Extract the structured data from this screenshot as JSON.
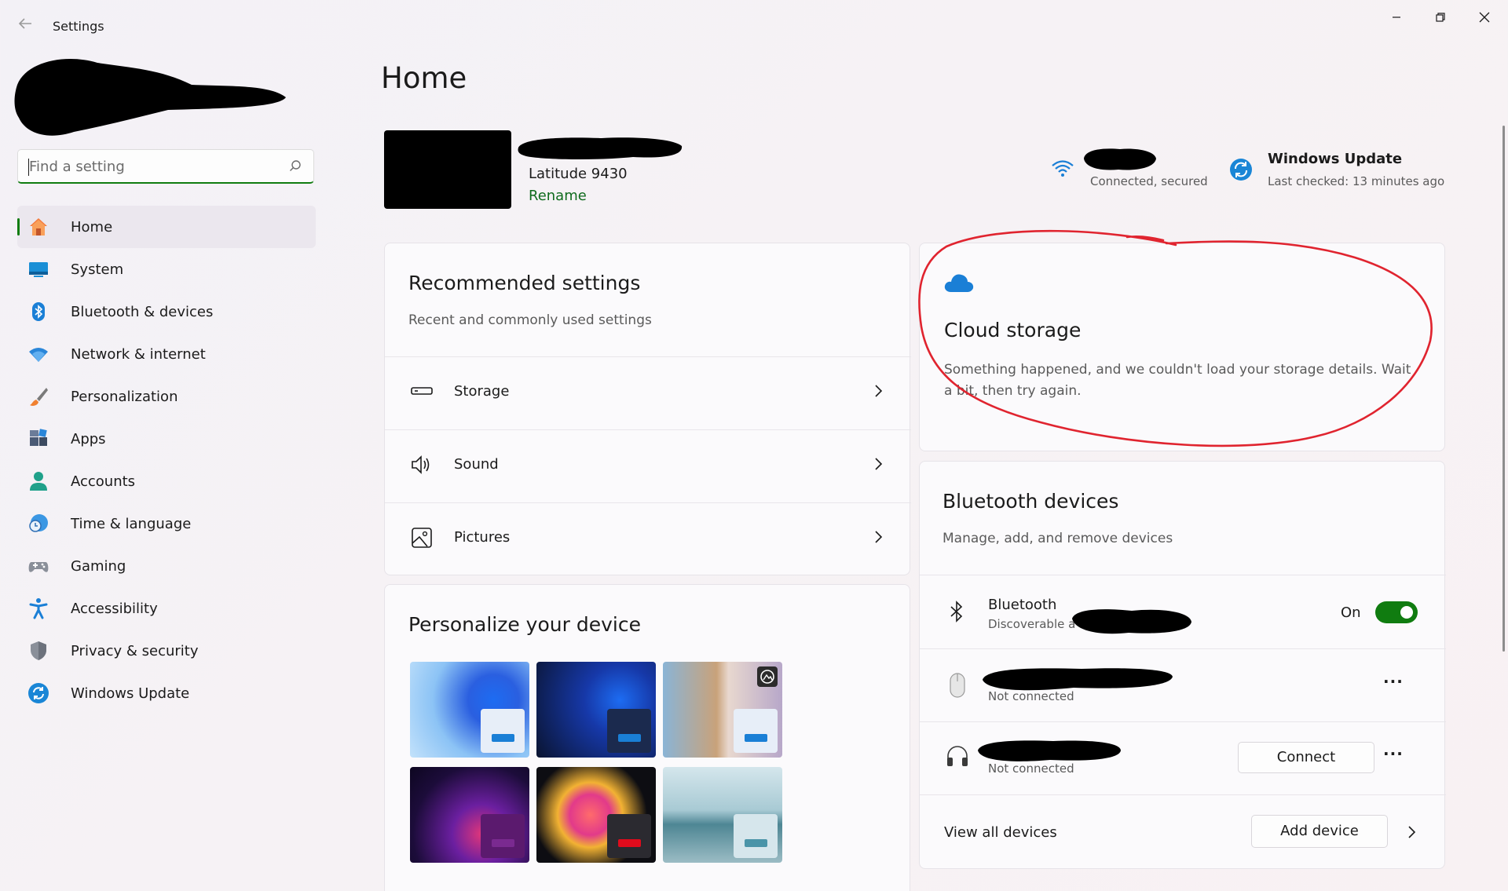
{
  "window": {
    "title": "Settings",
    "controls": [
      "minimize",
      "restore",
      "close"
    ]
  },
  "search": {
    "placeholder": "Find a setting"
  },
  "sidebar": {
    "items": [
      {
        "label": "Home",
        "icon": "home-icon",
        "active": true
      },
      {
        "label": "System",
        "icon": "system-icon"
      },
      {
        "label": "Bluetooth & devices",
        "icon": "bluetooth-icon"
      },
      {
        "label": "Network & internet",
        "icon": "wifi-icon"
      },
      {
        "label": "Personalization",
        "icon": "brush-icon"
      },
      {
        "label": "Apps",
        "icon": "apps-icon"
      },
      {
        "label": "Accounts",
        "icon": "person-icon"
      },
      {
        "label": "Time & language",
        "icon": "clock-globe-icon"
      },
      {
        "label": "Gaming",
        "icon": "gamepad-icon"
      },
      {
        "label": "Accessibility",
        "icon": "accessibility-icon"
      },
      {
        "label": "Privacy & security",
        "icon": "shield-icon"
      },
      {
        "label": "Windows Update",
        "icon": "update-icon"
      }
    ]
  },
  "main": {
    "title": "Home",
    "device": {
      "model": "Latitude 9430",
      "rename_label": "Rename"
    },
    "network": {
      "status": "Connected, secured"
    },
    "windows_update": {
      "title": "Windows Update",
      "status": "Last checked: 13 minutes ago"
    },
    "recommended": {
      "title": "Recommended settings",
      "subtitle": "Recent and commonly used settings",
      "rows": [
        {
          "label": "Storage",
          "icon": "storage-icon"
        },
        {
          "label": "Sound",
          "icon": "speaker-icon"
        },
        {
          "label": "Pictures",
          "icon": "picture-icon"
        }
      ]
    },
    "personalize": {
      "title": "Personalize your device"
    },
    "cloud": {
      "title": "Cloud storage",
      "message": "Something happened, and we couldn't load your storage details. Wait a bit, then try again."
    },
    "bluetooth": {
      "title": "Bluetooth devices",
      "subtitle": "Manage, add, and remove devices",
      "bt_label": "Bluetooth",
      "bt_sub": "Discoverable a",
      "bt_state": "On",
      "device1_status": "Not connected",
      "device2_status": "Not connected",
      "connect_label": "Connect",
      "more_label": "···",
      "view_all": "View all devices",
      "add_device": "Add device"
    }
  },
  "colors": {
    "accent": "#107c10",
    "annotation": "#e0242f"
  }
}
